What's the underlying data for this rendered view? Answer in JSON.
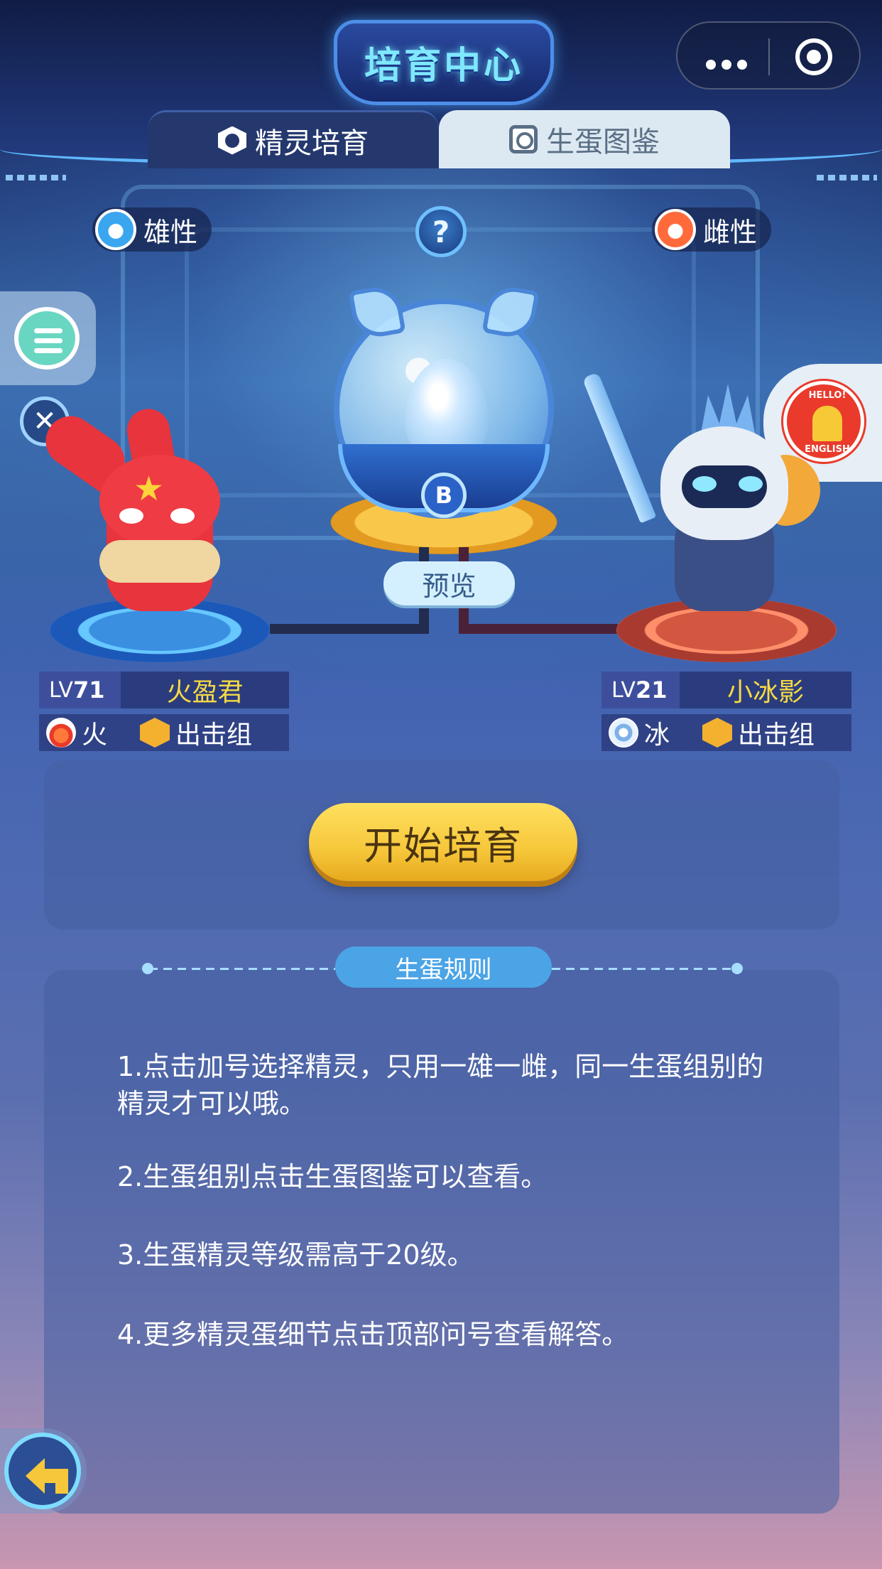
{
  "header": {
    "title": "培育中心",
    "capsule_more": "•••",
    "capsule_target": "◉"
  },
  "tabs": [
    {
      "label": "精灵培育",
      "icon": "hexagon-icon",
      "active": true
    },
    {
      "label": "生蛋图鉴",
      "icon": "book-icon",
      "active": false
    }
  ],
  "male": {
    "gender_label": "雄性",
    "level_prefix": "LV",
    "level": "71",
    "name": "火盈君",
    "element": "火",
    "group": "出击组"
  },
  "female": {
    "gender_label": "雌性",
    "level_prefix": "LV",
    "level": "21",
    "name": "小冰影",
    "element": "冰",
    "group": "出击组"
  },
  "help": {
    "label": "?"
  },
  "machine": {
    "emblem": "B",
    "preview_label": "预览"
  },
  "side": {
    "close_label": "✕"
  },
  "badge": {
    "line1": "HELLO!",
    "line2": "ENGLISH"
  },
  "actions": {
    "start_breed": "开始培育"
  },
  "rules": {
    "title": "生蛋规则",
    "items": [
      "1.点击加号选择精灵，只用一雄一雌，同一生蛋组别的精灵才可以哦。",
      "2.生蛋组别点击生蛋图鉴可以查看。",
      "3.生蛋精灵等级需高于20级。",
      "4.更多精灵蛋细节点击顶部问号查看解答。"
    ]
  },
  "colors": {
    "accent_yellow": "#f6c73a",
    "name_yellow": "#f7da43",
    "rules_blue": "#4ba4e6"
  }
}
